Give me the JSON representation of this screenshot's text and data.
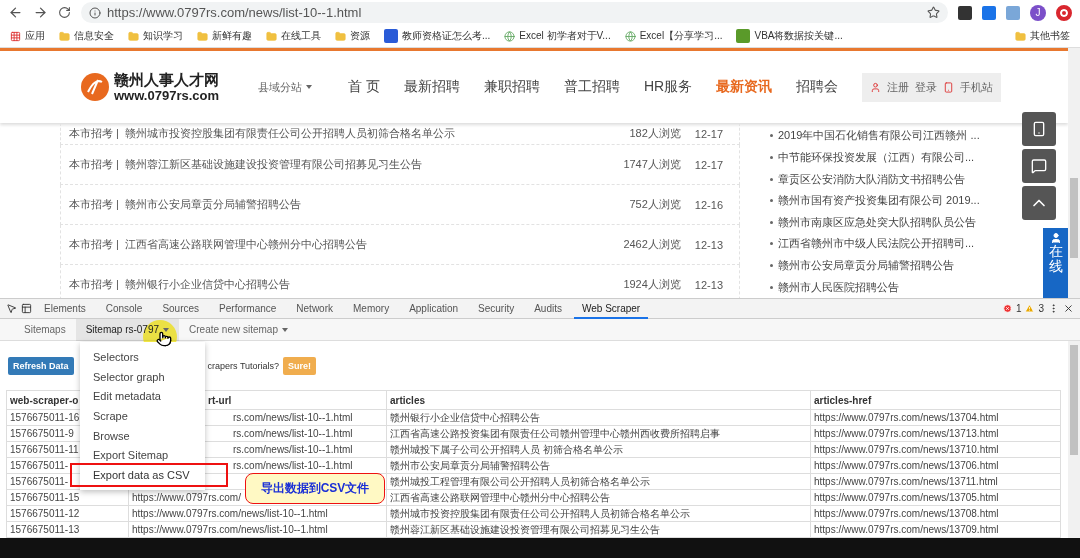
{
  "browser": {
    "url": "https://www.0797rs.com/news/list-10--1.html",
    "avatar": "J",
    "bookmarks": [
      {
        "kind": "apps",
        "label": "应用"
      },
      {
        "kind": "folder",
        "label": "信息安全"
      },
      {
        "kind": "folder",
        "label": "知识学习"
      },
      {
        "kind": "folder",
        "label": "新鲜有趣"
      },
      {
        "kind": "folder",
        "label": "在线工具"
      },
      {
        "kind": "folder",
        "label": "资源"
      },
      {
        "kind": "site",
        "label": "教师资格证怎么考..."
      },
      {
        "kind": "globe",
        "label": "Excel 初学者对于V..."
      },
      {
        "kind": "globe",
        "label": "Excel【分享学习..."
      },
      {
        "kind": "sheet",
        "label": "VBA将数据按关键..."
      }
    ],
    "other_bookmarks": "其他书签"
  },
  "site": {
    "logo_title": "赣州人事人才网",
    "logo_url": "www.0797rs.com",
    "branch": "县域分站",
    "nav": [
      {
        "label": "首 页",
        "selected": false
      },
      {
        "label": "最新招聘",
        "selected": false
      },
      {
        "label": "兼职招聘",
        "selected": false
      },
      {
        "label": "普工招聘",
        "selected": false
      },
      {
        "label": "HR服务",
        "selected": false
      },
      {
        "label": "最新资讯",
        "selected": true
      },
      {
        "label": "招聘会",
        "selected": false
      }
    ],
    "register": "注册",
    "login": "登录",
    "mobile": "手机站",
    "news": [
      {
        "category": "本市招考 |",
        "title": "赣州城市投资控股集团有限责任公司公开招聘人员初筛合格名单公示",
        "views": "182人浏览",
        "date": "12-17"
      },
      {
        "category": "本市招考 |",
        "title": "赣州蓉江新区基础设施建设投资管理有限公司招募见习生公告",
        "views": "1747人浏览",
        "date": "12-17"
      },
      {
        "category": "本市招考 |",
        "title": "赣州市公安局章贡分局辅警招聘公告",
        "views": "752人浏览",
        "date": "12-16"
      },
      {
        "category": "本市招考 |",
        "title": "江西省高速公路联网管理中心赣州分中心招聘公告",
        "views": "2462人浏览",
        "date": "12-13"
      },
      {
        "category": "本市招考 |",
        "title": "赣州银行小企业信贷中心招聘公告",
        "views": "1924人浏览",
        "date": "12-13"
      }
    ],
    "side_links": [
      "2019年中国石化销售有限公司江西赣州 ...",
      "中节能环保投资发展（江西）有限公司...",
      "章贡区公安消防大队消防文书招聘公告",
      "赣州市国有资产投资集团有限公司 2019...",
      "赣州市南康区应急处突大队招聘队员公告",
      "江西省赣州市中级人民法院公开招聘司...",
      "赣州市公安局章贡分局辅警招聘公告",
      "赣州市人民医院招聘公告"
    ],
    "service_tab": "在线"
  },
  "devtools": {
    "tabs": [
      {
        "label": "Elements",
        "selected": false
      },
      {
        "label": "Console",
        "selected": false
      },
      {
        "label": "Sources",
        "selected": false
      },
      {
        "label": "Performance",
        "selected": false
      },
      {
        "label": "Network",
        "selected": false
      },
      {
        "label": "Memory",
        "selected": false
      },
      {
        "label": "Application",
        "selected": false
      },
      {
        "label": "Security",
        "selected": false
      },
      {
        "label": "Audits",
        "selected": false
      },
      {
        "label": "Web Scraper",
        "selected": true
      }
    ],
    "errors": "1",
    "warnings": "3",
    "subnav": [
      {
        "label": "Sitemaps",
        "selected": false,
        "dropdown": false
      },
      {
        "label": "Sitemap rs-0797",
        "selected": true,
        "dropdown": true
      },
      {
        "label": "Create new sitemap",
        "selected": false,
        "dropdown": true
      }
    ],
    "menu": [
      {
        "label": "Selectors",
        "highlighted": false
      },
      {
        "label": "Selector graph",
        "highlighted": false
      },
      {
        "label": "Edit metadata",
        "highlighted": false
      },
      {
        "label": "Scrape",
        "highlighted": false
      },
      {
        "label": "Browse",
        "highlighted": false
      },
      {
        "label": "Export Sitemap",
        "highlighted": false
      },
      {
        "label": "Export data as CSV",
        "highlighted": true
      }
    ],
    "refresh_button": "Refresh Data",
    "tutorial_prompt": "crapers Tutorials?",
    "sure_button": "Sure!",
    "table": {
      "columns": [
        {
          "label": "web-scraper-o",
          "covered": false
        },
        {
          "label": "rt-url",
          "covered": true
        },
        {
          "label": "articles",
          "covered": false
        },
        {
          "label": "articles-href",
          "covered": false
        }
      ],
      "rows": [
        [
          {
            "text": "1576675011-16",
            "covered": false
          },
          {
            "text": "rs.com/news/list-10--1.html",
            "covered": true
          },
          {
            "text": "赣州银行小企业信贷中心招聘公告",
            "covered": false
          },
          {
            "text": "https://www.0797rs.com/news/13704.html",
            "covered": false
          }
        ],
        [
          {
            "text": "1576675011-9",
            "covered": false
          },
          {
            "text": "rs.com/news/list-10--1.html",
            "covered": true
          },
          {
            "text": "江西省高速公路投资集团有限责任公司赣州管理中心赣州西收费所招聘启事",
            "covered": false
          },
          {
            "text": "https://www.0797rs.com/news/13713.html",
            "covered": false
          }
        ],
        [
          {
            "text": "1576675011-11",
            "covered": false
          },
          {
            "text": "rs.com/news/list-10--1.html",
            "covered": true
          },
          {
            "text": "赣州城投下属子公司公开招聘人员 初筛合格名单公示",
            "covered": false
          },
          {
            "text": "https://www.0797rs.com/news/13710.html",
            "covered": false
          }
        ],
        [
          {
            "text": "1576675011-",
            "covered": false
          },
          {
            "text": "rs.com/news/list-10--1.html",
            "covered": true
          },
          {
            "text": "赣州市公安局章贡分局辅警招聘公告",
            "covered": false
          },
          {
            "text": "https://www.0797rs.com/news/13706.html",
            "covered": false
          }
        ],
        [
          {
            "text": "1576675011-",
            "covered": false
          },
          null,
          {
            "text": "赣州城投工程管理有限公司公开招聘人员初筛合格名单公示",
            "covered": false
          },
          {
            "text": "https://www.0797rs.com/news/13711.html",
            "covered": false
          }
        ],
        [
          {
            "text": "1576675011-15",
            "covered": false
          },
          {
            "text": "https://www.0797rs.com/",
            "covered": false
          },
          {
            "text": "江西省高速公路联网管理中心赣州分中心招聘公告",
            "covered": false
          },
          {
            "text": "https://www.0797rs.com/news/13705.html",
            "covered": false
          }
        ],
        [
          {
            "text": "1576675011-12",
            "covered": false
          },
          {
            "text": "https://www.0797rs.com/news/list-10--1.html",
            "covered": false
          },
          {
            "text": "赣州城市投资控股集团有限责任公司公开招聘人员初筛合格名单公示",
            "covered": false
          },
          {
            "text": "https://www.0797rs.com/news/13708.html",
            "covered": false
          }
        ],
        [
          {
            "text": "1576675011-13",
            "covered": false
          },
          {
            "text": "https://www.0797rs.com/news/list-10--1.html",
            "covered": false
          },
          {
            "text": "赣州蓉江新区基础设施建设投资管理有限公司招募见习生公告",
            "covered": false
          },
          {
            "text": "https://www.0797rs.com/news/13709.html",
            "covered": false
          }
        ]
      ]
    }
  },
  "callout": "导出数据到CSV文件"
}
